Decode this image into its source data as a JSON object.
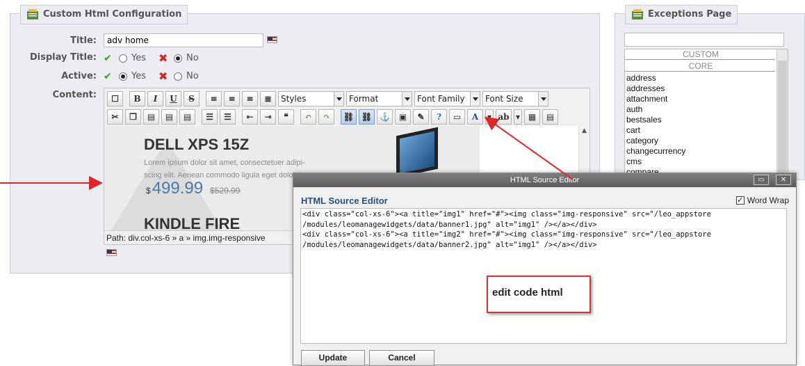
{
  "config": {
    "legend": "Custom Html Configuration",
    "title_label": "Title:",
    "title_value": "adv home",
    "display_title_label": "Display Title:",
    "active_label": "Active:",
    "content_label": "Content:",
    "yes": "Yes",
    "no": "No",
    "display_title_selected": "No",
    "active_selected": "Yes"
  },
  "editor": {
    "dropdowns": {
      "styles": "Styles",
      "format": "Format",
      "font_family": "Font Family",
      "font_size": "Font Size"
    },
    "banner": {
      "product1": "DELL XPS 15Z",
      "lorem": "Lorem ipsum dolor sit amet, consectetuer adipi-scing elit. Aenean commodo ligula eget dolor.",
      "currency": "$",
      "price": "499.99",
      "old_price": "$529.99",
      "product2": "KINDLE FIRE"
    },
    "path": "Path: div.col-xs-6 » a » img.img-responsive"
  },
  "exceptions": {
    "legend": "Exceptions Page",
    "groups": [
      "CUSTOM",
      "CORE"
    ],
    "items": [
      "address",
      "addresses",
      "attachment",
      "auth",
      "bestsales",
      "cart",
      "category",
      "changecurrency",
      "cms",
      "compare"
    ]
  },
  "dialog": {
    "title": "HTML Source Editor",
    "heading": "HTML Source Editor",
    "word_wrap": "Word Wrap",
    "word_wrap_checked": true,
    "code": "<div class=\"col-xs-6\"><a title=\"img1\" href=\"#\"><img class=\"img-responsive\" src=\"/leo_appstore\n/modules/leomanagewidgets/data/banner1.jpg\" alt=\"img1\" /></a></div>\n<div class=\"col-xs-6\"><a title=\"img2\" href=\"#\"><img class=\"img-responsive\" src=\"/leo_appstore\n/modules/leomanagewidgets/data/banner2.jpg\" alt=\"img1\" /></a></div>",
    "update": "Update",
    "cancel": "Cancel"
  },
  "annotation": {
    "note": "edit code html",
    "color": "#e0262a"
  }
}
